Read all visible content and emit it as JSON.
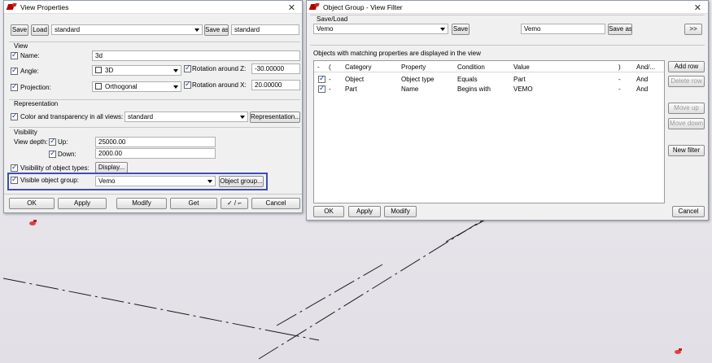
{
  "view_properties": {
    "title": "View Properties",
    "save": "Save",
    "load": "Load",
    "preset": "standard",
    "save_as": "Save as",
    "save_as_name": "standard",
    "view_section": "View",
    "name_label": "Name:",
    "name_value": "3d",
    "angle_label": "Angle:",
    "angle_value": "3D",
    "rot_z_label": "Rotation around Z:",
    "rot_z_value": "-30.00000",
    "projection_label": "Projection:",
    "projection_value": "Orthogonal",
    "rot_x_label": "Rotation around X:",
    "rot_x_value": "20.00000",
    "representation_section": "Representation",
    "color_label": "Color and transparency in all views:",
    "color_value": "standard",
    "representation_button": "Representation...",
    "visibility_section": "Visibility",
    "view_depth_label": "View depth:",
    "up_label": "Up:",
    "up_value": "25000.00",
    "down_label": "Down:",
    "down_value": "2000.00",
    "object_types_label": "Visibility of object types:",
    "display_button": "Display...",
    "group_label": "Visible object group:",
    "group_value": "Vemo",
    "object_group_button": "Object group...",
    "ok": "OK",
    "apply": "Apply",
    "modify": "Modify",
    "get": "Get",
    "toggle": "✓ / ⌐",
    "cancel": "Cancel"
  },
  "object_group": {
    "title": "Object Group - View Filter",
    "save_load_section": "Save/Load",
    "preset": "Vemo",
    "save": "Save",
    "save_as_name": "Vemo",
    "save_as": "Save as",
    "expand": ">>",
    "info": "Objects with matching properties are displayed in the view",
    "columns": [
      "-",
      "(",
      "Category",
      "Property",
      "Condition",
      "Value",
      ")",
      "And/..."
    ],
    "rows": [
      {
        "open": "-",
        "category": "Object",
        "property": "Object type",
        "condition": "Equals",
        "value": "Part",
        "close": "-",
        "andor": "And"
      },
      {
        "open": "-",
        "category": "Part",
        "property": "Name",
        "condition": "Begins with",
        "value": "VEMO",
        "close": "-",
        "andor": "And"
      }
    ],
    "add_row": "Add row",
    "delete_row": "Delete row",
    "move_up": "Move up",
    "move_down": "Move down",
    "new_filter": "New filter",
    "ok": "OK",
    "apply": "Apply",
    "modify": "Modify",
    "cancel": "Cancel"
  }
}
